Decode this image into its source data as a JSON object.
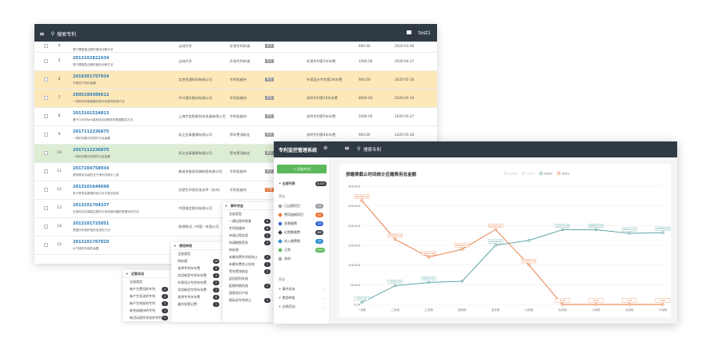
{
  "window1": {
    "search_label": "搜索专利",
    "user_label": "test1",
    "rows": [
      {
        "idx": "4",
        "no": "",
        "title": "基于螺旋复合管的催化分解方法",
        "applicant": "吉林大学",
        "type": "外观专利申请",
        "status": "未交",
        "stage": "",
        "fee": "600.00",
        "date": "2020-01-06",
        "bg": "#ffffff"
      },
      {
        "idx": "5",
        "no": "2013102822434",
        "title": "基于螺旋复合管的催化分解方法",
        "applicant": "吉林大学",
        "type": "外观专利申请",
        "status": "未交",
        "stage": "外观专利第1年年费",
        "fee": "1000.00",
        "date": "2020-04-27",
        "bg": "#ffffff"
      },
      {
        "idx": "6",
        "no": "2019301757934",
        "title": "车载空气净化装置",
        "applicant": "北京亚通科技有限公司",
        "type": "专利权维持",
        "status": "未交",
        "stage": "外观设计专利第2年年费",
        "fee": "900.00",
        "date": "2020-05-18",
        "bg": "#fce8b8"
      },
      {
        "idx": "7",
        "no": "2005100389612",
        "title": "一种带有风扇装置的移动电源的制造方法",
        "applicant": "中兴通讯股份有限公司",
        "type": "专利权维持",
        "status": "未交",
        "stage": "发明专利第10年年费",
        "fee": "8000.00",
        "date": "2020-05-19",
        "bg": "#fce8b8"
      },
      {
        "idx": "8",
        "no": "2013101524813",
        "title": "基于GIS的Web端系统应用程序的数据集成方法",
        "applicant": "上海华信智能科技发展有限公司",
        "type": "专利权维持",
        "status": "未交",
        "stage": "发明专利第5年年费",
        "fee": "2000.00",
        "date": "2020-05-27",
        "bg": "#ffffff"
      },
      {
        "idx": "9",
        "no": "2017112236875",
        "title": "一种前列腺炎的理疗仪及装置",
        "applicant": "浙江金泰健康有限公司",
        "type": "等年费滞纳金",
        "status": "未交",
        "stage": "发明专利第4年年费",
        "fee": "900.00",
        "date": "2020-05-28",
        "bg": "#ffffff"
      },
      {
        "idx": "10",
        "no": "2017112236875",
        "title": "一种前列腺炎的理疗仪及装置",
        "applicant": "浙江金泰健康有限公司",
        "type": "等年费滞纳金",
        "status": "未交",
        "stage": "发明专利第4年年费",
        "fee": "900.00",
        "date": "2020-05-28",
        "bg": "#dcedd3"
      },
      {
        "idx": "11",
        "no": "2017204758934",
        "title": "具有移动功能的空气净化机械手工具",
        "applicant": "慈溪市维发机械制造有限公司",
        "type": "专利权维持",
        "status": "未交",
        "stage": "实用新型专利第3年年费",
        "fee": "600.00",
        "date": "2020-06-02",
        "bg": "#ffffff"
      },
      {
        "idx": "12",
        "no": "2013101649698",
        "title": "电子签章及数据防伪方法与签名信息",
        "applicant": "艾默生环境优化技术（苏州）",
        "type": "专利权维持",
        "status": "已缴",
        "stage": "发明专利第8年年费",
        "fee": "2000.00",
        "date": "2020-06-04",
        "bg": "#ffffff"
      },
      {
        "idx": "13",
        "no": "2013101704337",
        "title": "应用测试后端监控服务中电池驱动器的数据测试方法",
        "applicant": "中国电信股份有限公司",
        "type": "专利权维持",
        "status": "未交",
        "stage": "发明专利第4年年费",
        "fee": "900.00",
        "date": "2020-06-05",
        "bg": "#ffffff"
      },
      {
        "idx": "14",
        "no": "2013101725051",
        "title": "数据分析维护相关信息的方法",
        "applicant": "联想移动（中国）有限公司",
        "type": "专利权维持",
        "status": "未交",
        "stage": "发明专利第6年年费",
        "fee": "2000.00",
        "date": "2020-06-09",
        "bg": "#ffffff"
      },
      {
        "idx": "15",
        "no": "2013101767020",
        "title": "水气循环利用的装置",
        "applicant": "浙江金泰健康有限公司",
        "type": "专利权维持",
        "status": "未交",
        "stage": "发明专利第5年年费",
        "fee": "2000.00",
        "date": "2020-06-12",
        "bg": "#ffffff"
      }
    ]
  },
  "dropdown_event": {
    "header": "事件状态",
    "items": [
      {
        "label": "全部类型",
        "badge": ""
      },
      {
        "label": "一通出案待答复",
        "badge": "6"
      },
      {
        "label": "专利权维持",
        "badge": "8"
      },
      {
        "label": "申请过程实质",
        "badge": "2"
      },
      {
        "label": "申请期限签发",
        "badge": "3"
      },
      {
        "label": "待处理",
        "badge": ""
      },
      {
        "label": "未缴年费专利权终止",
        "badge": "2"
      },
      {
        "label": "未缴年费终止失效",
        "badge": "1"
      },
      {
        "label": "等年费滞纳金",
        "badge": "2"
      },
      {
        "label": "返回权利失效",
        "badge": ""
      },
      {
        "label": "延期终期失效",
        "badge": "2"
      },
      {
        "label": "国家知识产权",
        "badge": ""
      },
      {
        "label": "国际局专利终止",
        "badge": "1"
      }
    ]
  },
  "dropdown_fee": {
    "header": "费用种类",
    "items": [
      {
        "label": "全部类型",
        "badge": ""
      },
      {
        "label": "待处理",
        "badge": "20"
      },
      {
        "label": "发明专利年年费",
        "badge": "8"
      },
      {
        "label": "实用新型专利年年费",
        "badge": "4"
      },
      {
        "label": "外观设计专利年年费",
        "badge": "2"
      },
      {
        "label": "实用新型专利年年费",
        "badge": "3"
      },
      {
        "label": "发明专利年年费",
        "badge": "6"
      },
      {
        "label": "著作权登记费",
        "badge": "1"
      }
    ]
  },
  "dropdown_recent": {
    "header": "近期活动",
    "items": [
      {
        "label": "全部类型",
        "badge": ""
      },
      {
        "label": "新产生费用的专利",
        "badge": "2"
      },
      {
        "label": "新产生发送的专利",
        "badge": "4"
      },
      {
        "label": "新产生授权的专利",
        "badge": "3"
      },
      {
        "label": "新完成维持的专利",
        "badge": "1"
      },
      {
        "label": "新活动案件状态的专利",
        "badge": "5"
      }
    ]
  },
  "window2": {
    "app_title": "专利监控管理系统",
    "search_label": "搜索专利",
    "add_button": "添加专利",
    "all_list": "全部列表",
    "all_count": "5/154",
    "section_filter": "筛选",
    "filters": [
      {
        "label": "已过期项目",
        "badge": "44",
        "color": "#9aa0a6"
      },
      {
        "label": "费用逾期项目",
        "badge": "24",
        "color": "#e8763a"
      },
      {
        "label": "急需缴费",
        "badge": "13",
        "color": "#3b6bd6"
      },
      {
        "label": "近期需缴费",
        "badge": "460",
        "color": "#3b3f44"
      },
      {
        "label": "进入缴费期",
        "badge": "23",
        "color": "#2f8fd6"
      },
      {
        "label": "正常",
        "badge": "2002",
        "color": "#5cb85c"
      },
      {
        "label": "其他",
        "badge": "",
        "color": "#aaaaaa"
      }
    ],
    "section_sort": "筛选",
    "sort_items": [
      {
        "label": "事件状态"
      },
      {
        "label": "费用种类"
      },
      {
        "label": "近期活动"
      }
    ],
    "colors": {
      "accent": "#5cb85c",
      "topbar": "#2f3a44"
    }
  },
  "chart_data": {
    "type": "line",
    "title": "按缴费截止时间统计应缴费用总金额",
    "legend_position": "top-right",
    "categories": [
      "一月份",
      "二月份",
      "三月份",
      "四月份",
      "五月份",
      "六月份",
      "七月份",
      "八月份",
      "九月份",
      "十月份"
    ],
    "ylim": [
      0,
      300000
    ],
    "yticks": [
      "0.00",
      "50,000",
      "100,000",
      "150,000",
      "200,000",
      "250,000",
      "300,000"
    ],
    "series": [
      {
        "name": "2018",
        "color": "#c8c8c8",
        "visible": false,
        "values": []
      },
      {
        "name": "2019",
        "color": "#c8c8c8",
        "visible": false,
        "values": []
      },
      {
        "name": "2020",
        "color": "#4d9a9a",
        "visible": true,
        "values": [
          5017.0,
          47600.0,
          55619.0,
          59000.0,
          150160.0,
          162570.0,
          189640.0,
          189640.0,
          180570.0,
          182040.0
        ],
        "labels": [
          "5017.00",
          "47600.00",
          "55619.00",
          "",
          "150160.00",
          "",
          "162570.00",
          "189640.00",
          "180570.00",
          "182040.00"
        ]
      },
      {
        "name": "2021",
        "color": "#e8763a",
        "visible": true,
        "values": [
          263420.0,
          165000.0,
          120000.0,
          140000.0,
          190000.0,
          100000.0,
          0.0,
          0.0,
          0.0,
          0.0
        ],
        "labels": [
          "263420.00",
          "165000.00",
          "120000.00",
          "160000.00",
          "190000.00",
          "100000.00",
          "0.00",
          "0.00",
          "0.00",
          "0.00"
        ]
      }
    ],
    "gridlines": true
  }
}
